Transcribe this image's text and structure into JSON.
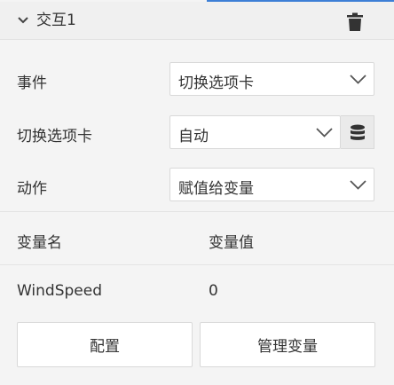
{
  "header": {
    "title": "交互1",
    "chevron_icon": "chevron-down-icon",
    "delete_icon": "trash-icon"
  },
  "event": {
    "label": "事件",
    "value": "切换选项卡"
  },
  "tab_switch": {
    "label": "切换选项卡",
    "value": "自动",
    "side_icon": "database-icon"
  },
  "action": {
    "label": "动作",
    "value": "赋值给变量"
  },
  "variables": {
    "name_header": "变量名",
    "value_header": "变量值",
    "rows": [
      {
        "name": "WindSpeed",
        "value": "0"
      }
    ]
  },
  "buttons": {
    "configure": "配置",
    "manage_variables": "管理变量"
  },
  "colors": {
    "accent": "#3d7fd6",
    "background": "#f4f4f4",
    "icon_dark": "#333333"
  }
}
